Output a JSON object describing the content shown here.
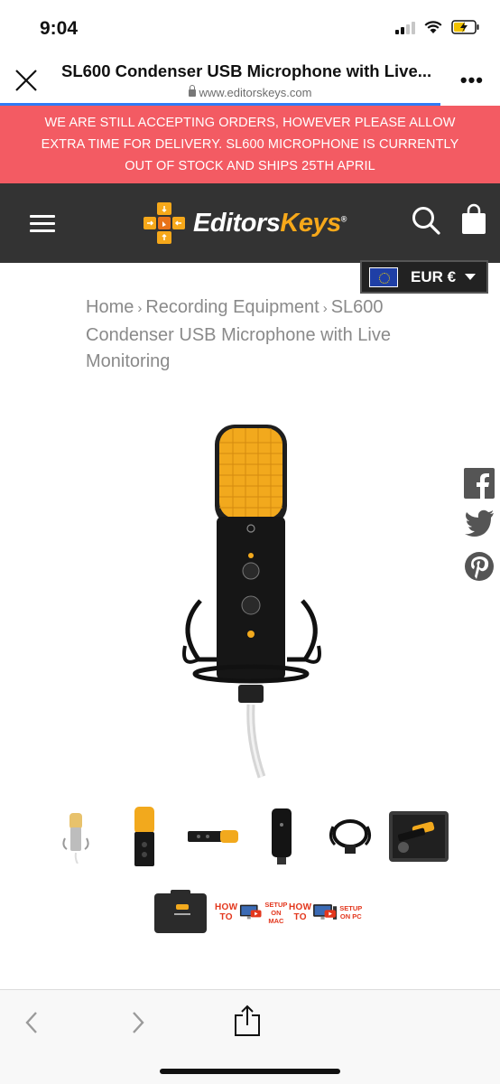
{
  "status_bar": {
    "time": "9:04"
  },
  "browser": {
    "page_title": "SL600 Condenser USB Microphone with Live...",
    "url": "www.editorskeys.com",
    "more_label": "•••"
  },
  "announcement": {
    "lines": [
      "WE ARE STILL ACCEPTING ORDERS, HOWEVER PLEASE ALLOW",
      "EXTRA TIME FOR DELIVERY. SL600 MICROPHONE IS CURRENTLY",
      "OUT OF STOCK AND SHIPS 25TH APRIL"
    ]
  },
  "header": {
    "logo_part1": "Editors",
    "logo_part2": "Keys",
    "logo_mark": "®"
  },
  "currency": {
    "label": "EUR €"
  },
  "breadcrumb": {
    "home": "Home",
    "sep": "›",
    "category": "Recording Equipment",
    "current": "SL600 Condenser USB Microphone with Live Monitoring"
  },
  "thumbnails": {
    "howto_mac_title": "HOW TO",
    "howto_mac_sub": "SETUP ON MAC",
    "howto_pc_title": "HOW TO",
    "howto_pc_sub": "SETUP ON PC"
  },
  "colors": {
    "banner": "#f35b63",
    "header": "#333333",
    "brand_orange": "#f6a81a"
  }
}
